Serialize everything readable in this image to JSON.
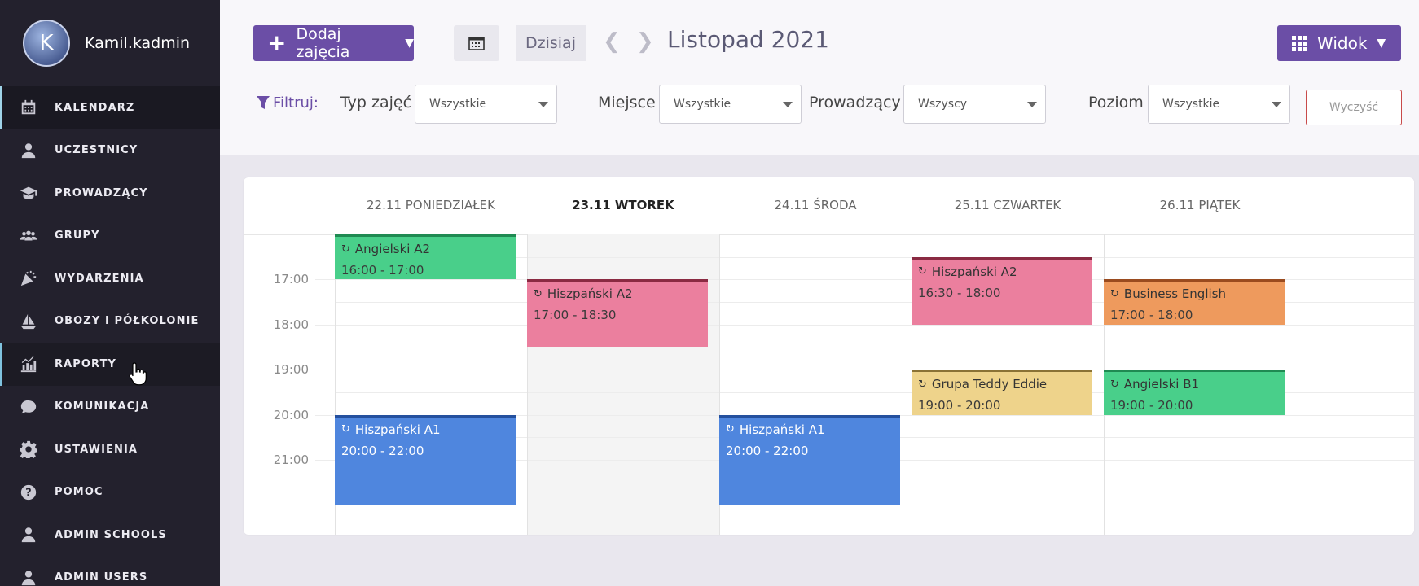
{
  "user": {
    "initial": "K",
    "name": "Kamil.kadmin"
  },
  "nav": [
    {
      "label": "KALENDARZ",
      "icon": "calendar-icon"
    },
    {
      "label": "UCZESTNICY",
      "icon": "user-icon"
    },
    {
      "label": "PROWADZĄCY",
      "icon": "graduation-cap-icon"
    },
    {
      "label": "GRUPY",
      "icon": "users-icon"
    },
    {
      "label": "WYDARZENIA",
      "icon": "party-icon"
    },
    {
      "label": "OBOZY I PÓŁKOLONIE",
      "icon": "sailboat-icon"
    },
    {
      "label": "RAPORTY",
      "icon": "chart-icon"
    },
    {
      "label": "KOMUNIKACJA",
      "icon": "chat-icon"
    },
    {
      "label": "USTAWIENIA",
      "icon": "gear-icon"
    },
    {
      "label": "POMOC",
      "icon": "help-icon"
    },
    {
      "label": "ADMIN SCHOOLS",
      "icon": "user-icon"
    },
    {
      "label": "ADMIN USERS",
      "icon": "user-icon"
    }
  ],
  "toolbar": {
    "add_label": "Dodaj zajęcia",
    "today_label": "Dzisiaj",
    "month": "Listopad 2021",
    "view_label": "Widok"
  },
  "filters": {
    "title": "Filtruj:",
    "type_label": "Typ zajęć",
    "type_value": "Wszystkie",
    "place_label": "Miejsce",
    "place_value": "Wszystkie",
    "teacher_label": "Prowadzący",
    "teacher_value": "Wszyscy",
    "level_label": "Poziom",
    "level_value": "Wszystkie",
    "clear_label": "Wyczyść"
  },
  "calendar": {
    "days": [
      "22.11 PONIEDZIAŁEK",
      "23.11 WTOREK",
      "24.11 ŚRODA",
      "25.11 CZWARTEK",
      "26.11 PIĄTEK"
    ],
    "today_index": 1,
    "hours": [
      "17:00",
      "18:00",
      "19:00",
      "20:00",
      "21:00"
    ],
    "events": [
      {
        "title": "Angielski A2",
        "time": "16:00 - 17:00",
        "day": 0,
        "start": 16.0,
        "end": 17.0,
        "color": "green"
      },
      {
        "title": "Hiszpański A1",
        "time": "20:00 - 22:00",
        "day": 0,
        "start": 20.0,
        "end": 22.0,
        "color": "blue"
      },
      {
        "title": "Hiszpański A2",
        "time": "17:00 - 18:30",
        "day": 1,
        "start": 17.0,
        "end": 18.5,
        "color": "pink"
      },
      {
        "title": "Hiszpański A1",
        "time": "20:00 - 22:00",
        "day": 2,
        "start": 20.0,
        "end": 22.0,
        "color": "blue"
      },
      {
        "title": "Hiszpański A2",
        "time": "16:30 - 18:00",
        "day": 3,
        "start": 16.5,
        "end": 18.0,
        "color": "pink"
      },
      {
        "title": "Grupa Teddy Eddie",
        "time": "19:00 - 20:00",
        "day": 3,
        "start": 19.0,
        "end": 20.0,
        "color": "yellow"
      },
      {
        "title": "Business English",
        "time": "17:00 - 18:00",
        "day": 4,
        "start": 17.0,
        "end": 18.0,
        "color": "orange"
      },
      {
        "title": "Angielski B1",
        "time": "19:00 - 20:00",
        "day": 4,
        "start": 19.0,
        "end": 20.0,
        "color": "green"
      }
    ]
  }
}
